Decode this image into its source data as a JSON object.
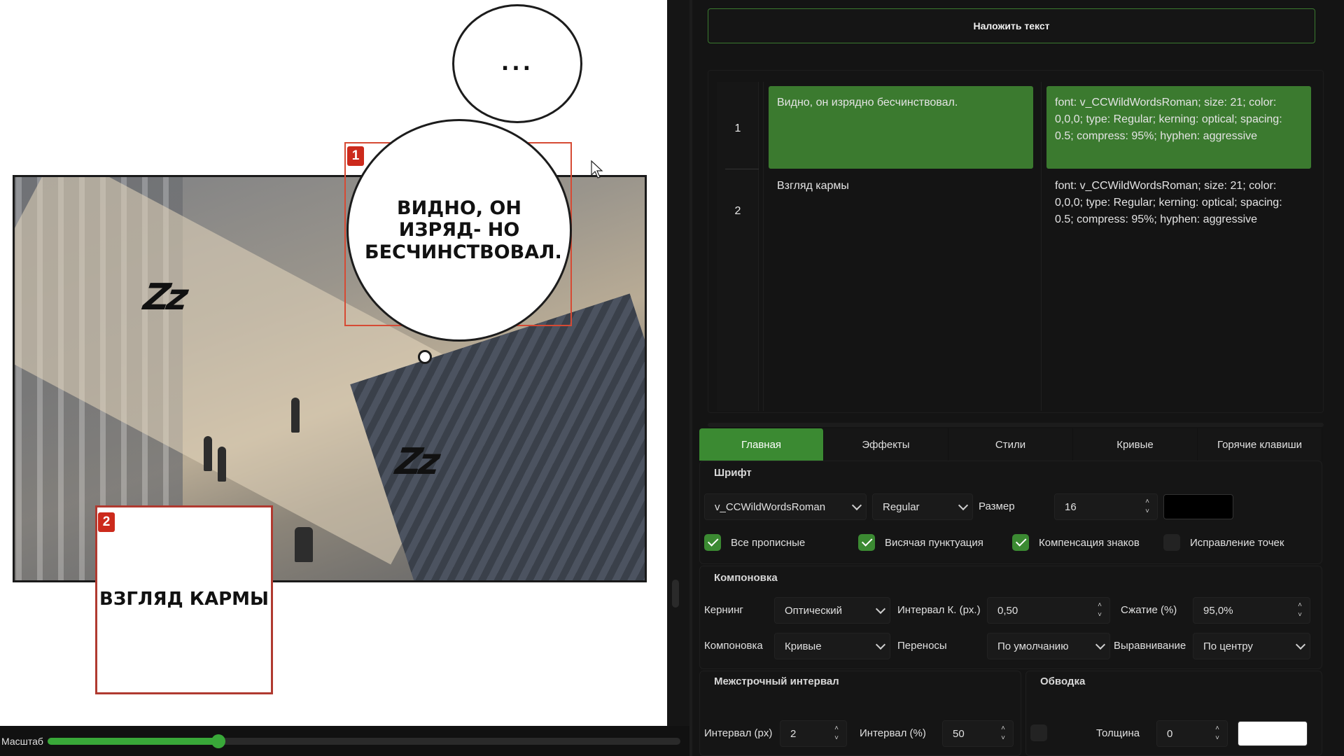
{
  "canvas": {
    "bubble_top_text": "...",
    "bubble_main_text": "ВИДНО, ОН ИЗРЯД- НО БЕСЧИНСТВОВАЛ.",
    "caption_text": "ВЗГЛЯД КАРМЫ",
    "badge_1": "1",
    "badge_2": "2",
    "sfx_text": "Zz"
  },
  "zoom": {
    "label": "Масштаб",
    "value_fraction": 0.27
  },
  "toolbar": {
    "apply_text_button": "Наложить текст"
  },
  "table": {
    "rows": [
      {
        "num": "1",
        "text": "Видно, он изрядно бесчинствовал.",
        "style": "font: v_CCWildWordsRoman; size: 21; color: 0,0,0; type: Regular; kerning: optical; spacing: 0.5; compress: 95%; hyphen: aggressive",
        "selected": true
      },
      {
        "num": "2",
        "text": "Взгляд кармы",
        "style": "font: v_CCWildWordsRoman; size: 21; color: 0,0,0; type: Regular; kerning: optical; spacing: 0.5; compress: 95%; hyphen: aggressive",
        "selected": false
      }
    ]
  },
  "tabs": [
    {
      "label": "Главная",
      "active": true
    },
    {
      "label": "Эффекты",
      "active": false
    },
    {
      "label": "Стили",
      "active": false
    },
    {
      "label": "Кривые",
      "active": false
    },
    {
      "label": "Горячие клавиши",
      "active": false
    }
  ],
  "font_group": {
    "title": "Шрифт",
    "font_name": "v_CCWildWordsRoman",
    "font_style": "Regular",
    "size_label": "Размер",
    "size_value": "16",
    "color": "#000000",
    "checkboxes": [
      {
        "label": "Все прописные",
        "checked": true
      },
      {
        "label": "Висячая пунктуация",
        "checked": true
      },
      {
        "label": "Компенсация знаков",
        "checked": true
      },
      {
        "label": "Исправление точек",
        "checked": false
      }
    ]
  },
  "layout_group": {
    "title": "Компоновка",
    "kerning_label": "Кернинг",
    "kerning_value": "Оптический",
    "interval_label": "Интервал К. (px.)",
    "interval_value": "0,50",
    "compress_label": "Сжатие (%)",
    "compress_value": "95,0%",
    "layout_label": "Компоновка",
    "layout_value": "Кривые",
    "hyphen_label": "Переносы",
    "hyphen_value": "По умолчанию",
    "align_label": "Выравнивание",
    "align_value": "По центру"
  },
  "line_spacing_group": {
    "title": "Межстрочный интервал",
    "px_label": "Интервал (px)",
    "px_value": "2",
    "pct_label": "Интервал (%)",
    "pct_value": "50"
  },
  "stroke_group": {
    "title": "Обводка",
    "enabled": false,
    "width_label": "Толщина",
    "width_value": "0",
    "color": "#ffffff"
  },
  "colors": {
    "accent": "#3b8a32",
    "selection": "#3b7a2f",
    "badge": "#cc2a1c"
  }
}
